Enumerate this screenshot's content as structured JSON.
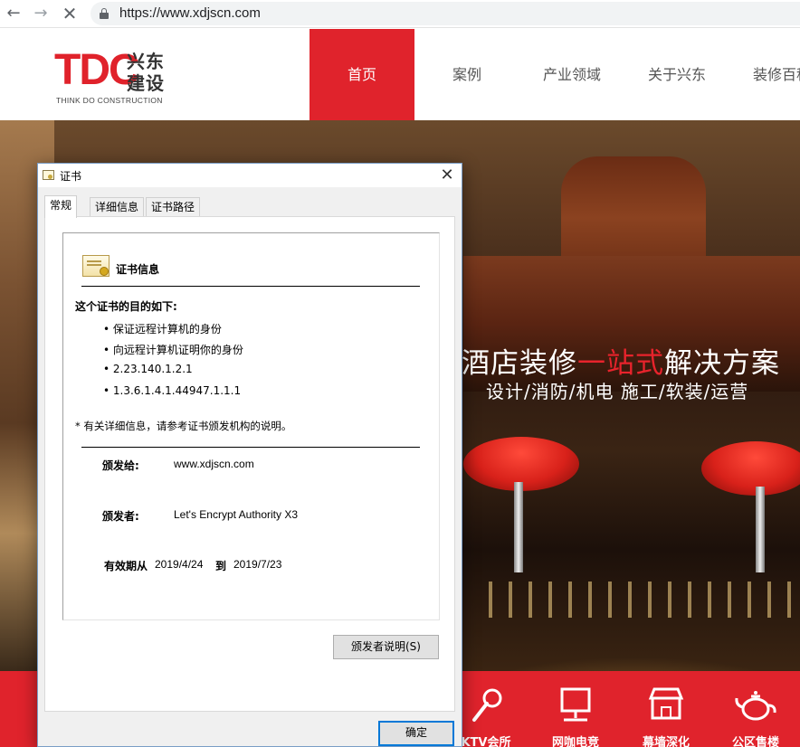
{
  "browser": {
    "url": "https://www.xdjscn.com"
  },
  "site": {
    "logo": {
      "mark": "TDC",
      "cn_line1": "兴东",
      "cn_line2": "建设",
      "en": "THINK DO CONSTRUCTION",
      "color": "#e0222b"
    },
    "nav": [
      {
        "label": "首页",
        "active": true
      },
      {
        "label": "案例",
        "active": false
      },
      {
        "label": "产业领域",
        "active": false
      },
      {
        "label": "关于兴东",
        "active": false
      },
      {
        "label": "装修百科",
        "active": false
      }
    ],
    "accent": "#e0232c"
  },
  "hero": {
    "title_before": "酒店装修",
    "title_highlight": "一站式",
    "title_after": "解决方案",
    "subtitle": "设计/消防/机电  施工/软装/运营"
  },
  "services": [
    {
      "label": "KTV会所",
      "icon": "microphone-icon"
    },
    {
      "label": "网咖电竞",
      "icon": "computer-icon"
    },
    {
      "label": "幕墙深化",
      "icon": "storefront-icon"
    },
    {
      "label": "公区售楼",
      "icon": "teapot-icon"
    }
  ],
  "dialog": {
    "title": "证书",
    "close": "✕",
    "tabs": [
      {
        "label": "常规",
        "active": true
      },
      {
        "label": "详细信息",
        "active": false
      },
      {
        "label": "证书路径",
        "active": false
      }
    ],
    "cert_heading": "证书信息",
    "purpose_heading": "这个证书的目的如下:",
    "purposes": [
      "• 保证远程计算机的身份",
      "• 向远程计算机证明你的身份",
      "• 2.23.140.1.2.1",
      "• 1.3.6.1.4.1.44947.1.1.1"
    ],
    "note": "* 有关详细信息，请参考证书颁发机构的说明。",
    "issued_to_label": "颁发给:",
    "issued_to": "www.xdjscn.com",
    "issued_by_label": "颁发者:",
    "issued_by": "Let's Encrypt Authority X3",
    "valid_from_label": "有效期从",
    "valid_from": "2019/4/24",
    "valid_to_label": "到",
    "valid_to": "2019/7/23",
    "issuer_statement_button": "颁发者说明(S)",
    "ok_button": "确定"
  }
}
